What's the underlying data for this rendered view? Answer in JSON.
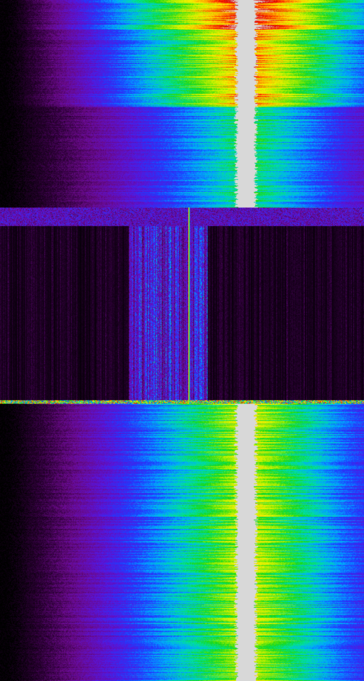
{
  "waterfall": {
    "description_colors": {
      "background": "#000000",
      "idle_floor": "#0d0010",
      "peak": "#d8d8d8",
      "palette": [
        "#000000",
        "#2a0033",
        "#6a0a8a",
        "#5a14d8",
        "#1e3cff",
        "#00a8ff",
        "#00e0a0",
        "#18d818",
        "#b0f000",
        "#f8f000",
        "#ffa000",
        "#ff2a00",
        "#d80000",
        "#d8d8d8"
      ]
    },
    "segments": [
      {
        "kind": "signal",
        "level": 1.0
      },
      {
        "kind": "signal",
        "level": 0.85
      },
      {
        "kind": "signal",
        "level": 0.55
      },
      {
        "kind": "noise",
        "level": 0.1
      },
      {
        "kind": "signal",
        "level": 0.7
      }
    ],
    "signal_center_fraction": 0.675,
    "idle_carrier_fraction": 0.518
  }
}
